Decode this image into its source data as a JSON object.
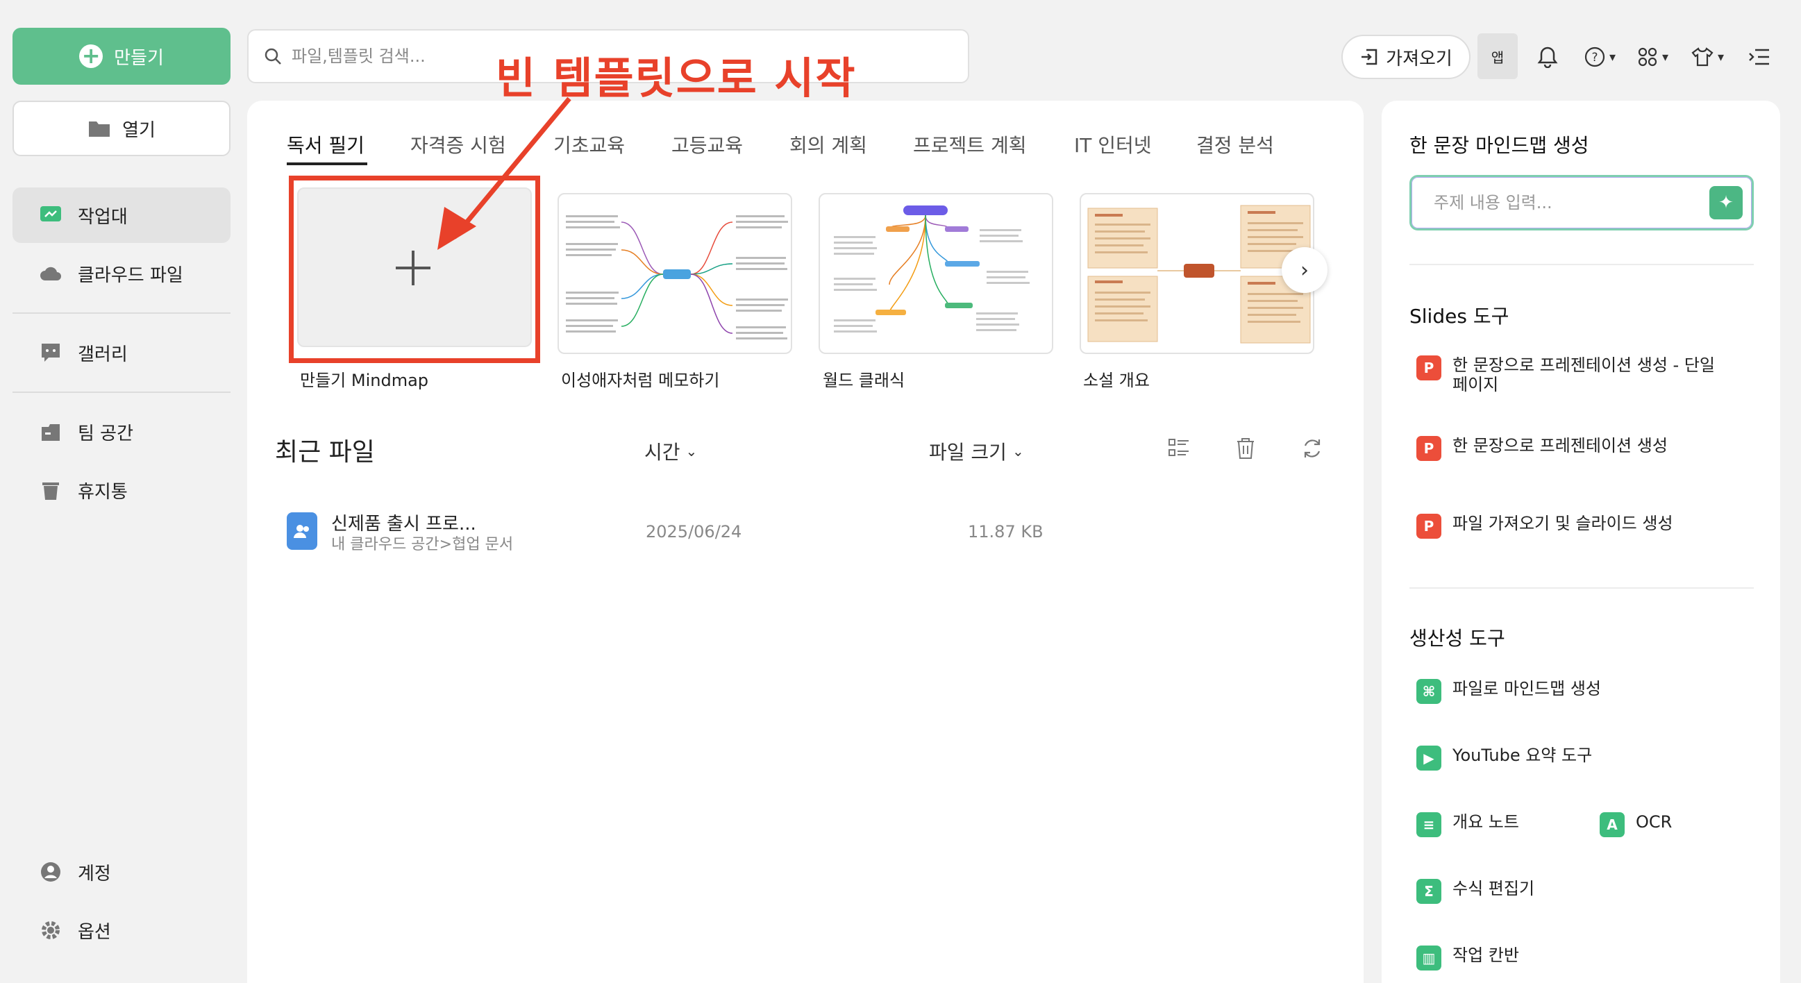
{
  "sidebar": {
    "create_label": "만들기",
    "open_label": "열기",
    "items": [
      {
        "label": "작업대"
      },
      {
        "label": "클라우드 파일"
      },
      {
        "label": "갤러리"
      },
      {
        "label": "팀 공간"
      },
      {
        "label": "휴지통"
      },
      {
        "label": "계정"
      },
      {
        "label": "옵션"
      }
    ]
  },
  "topbar": {
    "search_placeholder": "파일,템플릿 검색...",
    "import_label": "가져오기",
    "app_label": "앱"
  },
  "annotation": "빈 템플릿으로 시작",
  "tabs": [
    {
      "label": "독서 필기"
    },
    {
      "label": "자격증 시험"
    },
    {
      "label": "기초교육"
    },
    {
      "label": "고등교육"
    },
    {
      "label": "회의 계획"
    },
    {
      "label": "프로젝트 계획"
    },
    {
      "label": "IT 인터넷"
    },
    {
      "label": "결정 분석"
    }
  ],
  "templates": [
    {
      "label": "만들기 Mindmap"
    },
    {
      "label": "이성애자처럼 메모하기"
    },
    {
      "label": "월드 클래식"
    },
    {
      "label": "소설 개요"
    }
  ],
  "recent": {
    "title": "최근 파일",
    "col_time": "시간",
    "col_size": "파일 크기",
    "files": [
      {
        "name": "신제품 출시 프로...",
        "path": "내 클라우드 공간>협업 문서",
        "date": "2025/06/24",
        "size": "11.87 KB"
      }
    ]
  },
  "right": {
    "ai_title": "한 문장 마인드맵 생성",
    "ai_placeholder": "주제 내용 입력...",
    "slides_title": "Slides 도구",
    "slides_items": [
      {
        "label": "한 문장으로 프레젠테이션 생성 - 단일",
        "label2": "페이지"
      },
      {
        "label": "한 문장으로 프레젠테이션 생성"
      },
      {
        "label": "파일 가져오기 및 슬라이드 생성"
      }
    ],
    "prod_title": "생산성 도구",
    "prod_items": [
      {
        "label": "파일로 마인드맵 생성"
      },
      {
        "label": "YouTube 요약 도구"
      },
      {
        "label": "개요 노트"
      },
      {
        "label": "OCR"
      },
      {
        "label": "수식 편집기"
      },
      {
        "label": "작업 칸반"
      }
    ]
  },
  "colors": {
    "accent": "#5fbf8d",
    "annotation": "#e8412a"
  }
}
